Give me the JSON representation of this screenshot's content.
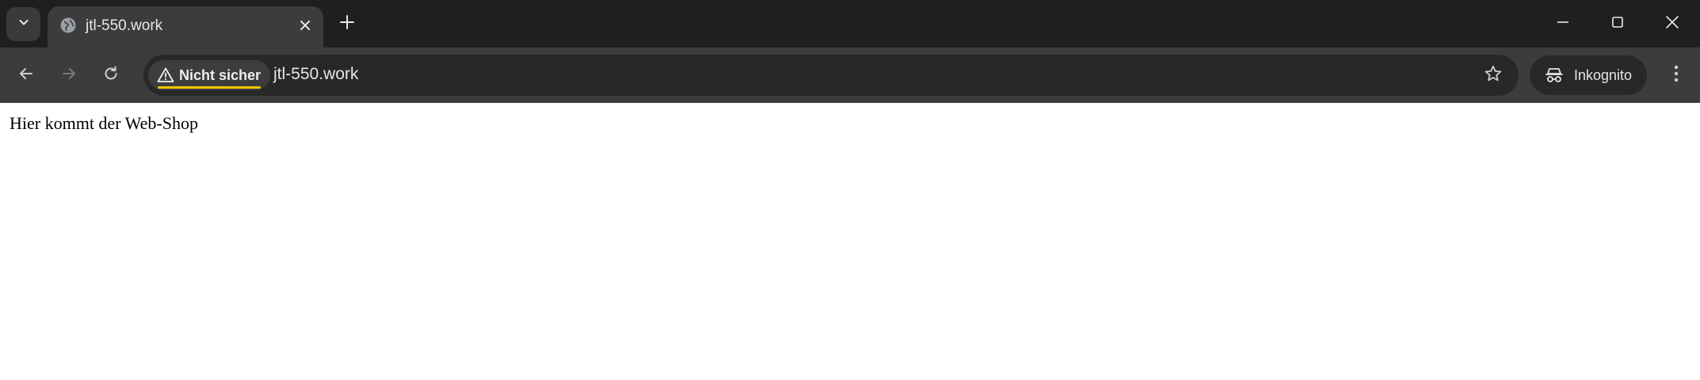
{
  "browser": {
    "tab": {
      "title": "jtl-550.work",
      "favicon_icon": "globe-icon",
      "close_icon": "close-icon"
    },
    "tab_search_icon": "chevron-down-icon",
    "new_tab_icon": "plus-icon",
    "window_controls": {
      "minimize_icon": "minimize-icon",
      "maximize_icon": "maximize-icon",
      "close_icon": "close-icon"
    },
    "toolbar": {
      "back_icon": "arrow-left-icon",
      "forward_icon": "arrow-right-icon",
      "reload_icon": "reload-icon",
      "security_label": "Nicht sicher",
      "security_icon": "warning-triangle-icon",
      "url": "jtl-550.work",
      "bookmark_icon": "star-icon",
      "profile_label": "Inkognito",
      "profile_icon": "incognito-icon",
      "menu_icon": "kebab-menu-icon"
    },
    "colors": {
      "tabstrip_bg": "#1f1f1f",
      "toolbar_bg": "#3c3c3c",
      "omnibox_bg": "#282828",
      "warning_underline": "#f4c400"
    }
  },
  "page": {
    "body_text": "Hier kommt der Web-Shop"
  }
}
